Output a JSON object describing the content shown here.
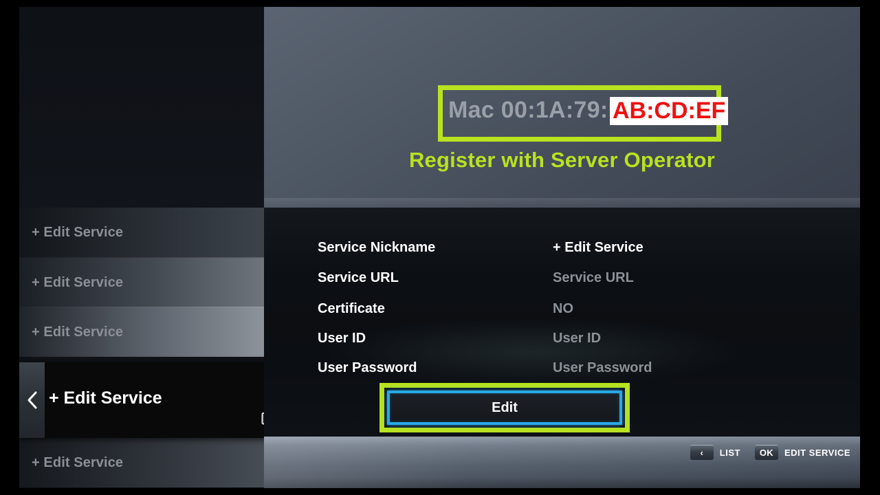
{
  "hero": {
    "mac_prefix": "Mac 00:1A:79:",
    "mac_highlight": "AB:CD:EF",
    "annotation": "Register with Server Operator",
    "annotation_color": "#b9e21f",
    "highlight_text_color": "#ee1111",
    "highlight_bg_color": "#ffffff"
  },
  "sidebar": {
    "items": [
      {
        "label": "+ Edit Service",
        "selected": false
      },
      {
        "label": "+ Edit Service",
        "selected": false
      },
      {
        "label": "+ Edit Service",
        "selected": false
      },
      {
        "label": "+ Edit Service",
        "selected": true,
        "icon": "monitor-icon",
        "back_icon": "chevron-left-icon"
      },
      {
        "label": "+ Edit Service",
        "selected": false
      }
    ]
  },
  "form": {
    "rows": [
      {
        "label": "Service Nickname",
        "value": "+ Edit Service",
        "bright": true
      },
      {
        "label": "Service URL",
        "value": "Service URL",
        "bright": false
      },
      {
        "label": "Certificate",
        "value": "NO",
        "bright": false
      },
      {
        "label": "User ID",
        "value": "User ID",
        "bright": false
      },
      {
        "label": "User Password",
        "value": "User Password",
        "bright": false
      }
    ],
    "edit_button": "Edit",
    "edit_button_border_color": "#29a8e6"
  },
  "footer": {
    "hints": [
      {
        "key": "‹",
        "label": "LIST"
      },
      {
        "key": "OK",
        "label": "EDIT SERVICE"
      }
    ]
  }
}
